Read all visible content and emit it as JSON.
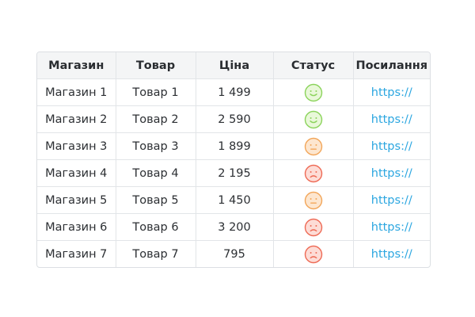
{
  "table": {
    "headers": [
      "Магазин",
      "Товар",
      "Ціна",
      "Статус",
      "Посилання"
    ],
    "rows": [
      {
        "shop": "Магазин 1",
        "product": "Товар 1",
        "price": "1 499",
        "status": "happy",
        "link": "https://"
      },
      {
        "shop": "Магазин 2",
        "product": "Товар 2",
        "price": "2 590",
        "status": "happy",
        "link": "https://"
      },
      {
        "shop": "Магазин 3",
        "product": "Товар 3",
        "price": "1 899",
        "status": "neutral",
        "link": "https://"
      },
      {
        "shop": "Магазин 4",
        "product": "Товар 4",
        "price": "2 195",
        "status": "sad",
        "link": "https://"
      },
      {
        "shop": "Магазин 5",
        "product": "Товар 5",
        "price": "1 450",
        "status": "neutral",
        "link": "https://"
      },
      {
        "shop": "Магазин 6",
        "product": "Товар 6",
        "price": "3 200",
        "status": "sad",
        "link": "https://"
      },
      {
        "shop": "Магазин 7",
        "product": "Товар 7",
        "price": "795",
        "status": "sad",
        "link": "https://"
      }
    ]
  },
  "status_styles": {
    "happy": {
      "icon": "smiling-face-icon",
      "fill": "#e9f8d9",
      "stroke": "#8bd35b"
    },
    "neutral": {
      "icon": "neutral-face-icon",
      "fill": "#fde6cf",
      "stroke": "#f2a65a"
    },
    "sad": {
      "icon": "frowning-face-icon",
      "fill": "#fddcd6",
      "stroke": "#ee6a55"
    }
  }
}
